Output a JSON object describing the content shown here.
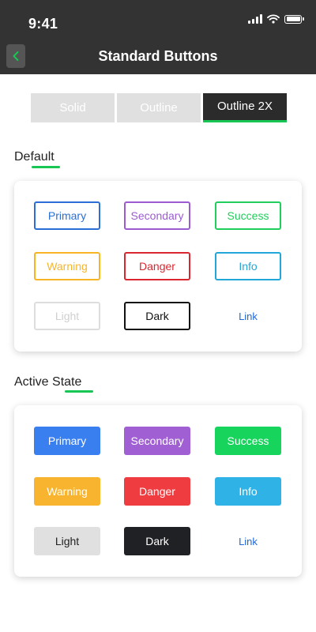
{
  "status_bar": {
    "time": "9:41"
  },
  "header": {
    "title": "Standard Buttons"
  },
  "tabs": [
    {
      "label": "Solid"
    },
    {
      "label": "Outline"
    },
    {
      "label": "Outline 2X"
    }
  ],
  "sections": {
    "default": {
      "title": "Default",
      "buttons": [
        {
          "label": "Primary",
          "color": "#2b6fd6"
        },
        {
          "label": "Secondary",
          "color": "#9c5bd0"
        },
        {
          "label": "Success",
          "color": "#1fce5b"
        },
        {
          "label": "Warning",
          "color": "#f7b526"
        },
        {
          "label": "Danger",
          "color": "#d9262f"
        },
        {
          "label": "Info",
          "color": "#22a8d8"
        },
        {
          "label": "Light",
          "color": "#dddddd"
        },
        {
          "label": "Dark",
          "color": "#111111"
        },
        {
          "label": "Link",
          "color": "#1e66d6"
        }
      ]
    },
    "active": {
      "title": "Active State",
      "buttons": [
        {
          "label": "Primary",
          "color": "#3a7ff0"
        },
        {
          "label": "Secondary",
          "color": "#a05fd2"
        },
        {
          "label": "Success",
          "color": "#16d45c"
        },
        {
          "label": "Warning",
          "color": "#f8b42e"
        },
        {
          "label": "Danger",
          "color": "#ee3c40"
        },
        {
          "label": "Info",
          "color": "#2fb2e6"
        },
        {
          "label": "Light",
          "color": "#e0e0e0"
        },
        {
          "label": "Dark",
          "color": "#202124"
        },
        {
          "label": "Link",
          "color": "#1e66d6"
        }
      ]
    }
  },
  "colors": {
    "accent": "#17c653",
    "appbar": "#333333"
  }
}
